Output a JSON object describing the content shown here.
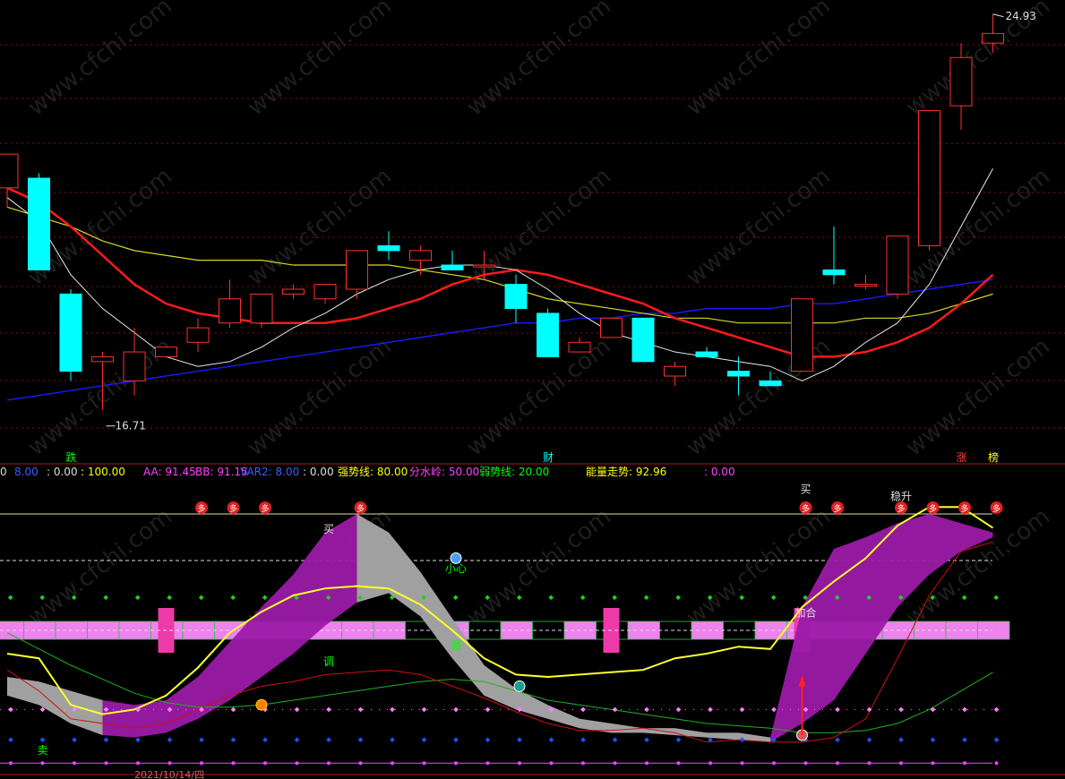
{
  "chart_data": [
    {
      "type": "candlestick",
      "panel": "price",
      "price_high_label": "24.93",
      "price_low_label": "16.71",
      "ylim": [
        15.6,
        25.1
      ],
      "candles": [
        {
          "o": 21.3,
          "h": 22.0,
          "l": 20.9,
          "c": 22.0
        },
        {
          "o": 21.5,
          "h": 21.6,
          "l": 19.6,
          "c": 19.6
        },
        {
          "o": 19.1,
          "h": 19.2,
          "l": 17.3,
          "c": 17.5
        },
        {
          "o": 17.7,
          "h": 17.9,
          "l": 16.7,
          "c": 17.8
        },
        {
          "o": 17.3,
          "h": 18.4,
          "l": 17.0,
          "c": 17.9
        },
        {
          "o": 17.8,
          "h": 18.0,
          "l": 17.8,
          "c": 18.0
        },
        {
          "o": 18.1,
          "h": 18.6,
          "l": 17.9,
          "c": 18.4
        },
        {
          "o": 18.5,
          "h": 19.4,
          "l": 18.4,
          "c": 19.0
        },
        {
          "o": 18.5,
          "h": 19.1,
          "l": 18.4,
          "c": 19.1
        },
        {
          "o": 19.1,
          "h": 19.3,
          "l": 19.0,
          "c": 19.2
        },
        {
          "o": 19.0,
          "h": 19.3,
          "l": 18.9,
          "c": 19.3
        },
        {
          "o": 19.2,
          "h": 20.0,
          "l": 19.0,
          "c": 20.0
        },
        {
          "o": 20.1,
          "h": 20.4,
          "l": 19.8,
          "c": 20.0
        },
        {
          "o": 19.8,
          "h": 20.1,
          "l": 19.5,
          "c": 20.0
        },
        {
          "o": 19.7,
          "h": 20.0,
          "l": 19.6,
          "c": 19.6
        },
        {
          "o": 19.7,
          "h": 20.0,
          "l": 19.4,
          "c": 19.7
        },
        {
          "o": 19.3,
          "h": 19.5,
          "l": 18.5,
          "c": 18.8
        },
        {
          "o": 18.7,
          "h": 18.8,
          "l": 17.8,
          "c": 17.8
        },
        {
          "o": 17.9,
          "h": 18.2,
          "l": 17.9,
          "c": 18.1
        },
        {
          "o": 18.2,
          "h": 18.6,
          "l": 18.2,
          "c": 18.6
        },
        {
          "o": 18.6,
          "h": 18.6,
          "l": 17.7,
          "c": 17.7
        },
        {
          "o": 17.4,
          "h": 17.7,
          "l": 17.2,
          "c": 17.6
        },
        {
          "o": 17.9,
          "h": 18.0,
          "l": 17.8,
          "c": 17.8
        },
        {
          "o": 17.5,
          "h": 17.8,
          "l": 17.0,
          "c": 17.4
        },
        {
          "o": 17.3,
          "h": 17.5,
          "l": 17.2,
          "c": 17.2
        },
        {
          "o": 17.5,
          "h": 19.0,
          "l": 17.5,
          "c": 19.0
        },
        {
          "o": 19.6,
          "h": 20.5,
          "l": 19.3,
          "c": 19.5
        },
        {
          "o": 19.3,
          "h": 19.5,
          "l": 19.2,
          "c": 19.3
        },
        {
          "o": 19.1,
          "h": 20.3,
          "l": 19.0,
          "c": 20.3
        },
        {
          "o": 20.1,
          "h": 22.9,
          "l": 20.0,
          "c": 22.9
        },
        {
          "o": 23.0,
          "h": 24.3,
          "l": 22.5,
          "c": 24.0
        },
        {
          "o": 24.3,
          "h": 24.9,
          "l": 24.1,
          "c": 24.5
        }
      ],
      "ma_white": [
        21.1,
        20.6,
        19.5,
        18.8,
        18.3,
        17.8,
        17.6,
        17.7,
        18.0,
        18.4,
        18.7,
        19.1,
        19.4,
        19.6,
        19.7,
        19.7,
        19.6,
        19.2,
        18.7,
        18.3,
        18.1,
        17.9,
        17.8,
        17.7,
        17.6,
        17.3,
        17.6,
        18.1,
        18.5,
        19.3,
        20.5,
        21.7
      ],
      "ma_red": [
        21.3,
        21.0,
        20.5,
        19.9,
        19.3,
        18.9,
        18.7,
        18.6,
        18.5,
        18.5,
        18.5,
        18.6,
        18.8,
        19.0,
        19.3,
        19.5,
        19.6,
        19.5,
        19.3,
        19.1,
        18.9,
        18.6,
        18.4,
        18.2,
        18.0,
        17.8,
        17.8,
        17.9,
        18.1,
        18.4,
        18.9,
        19.5
      ],
      "ma_yellow": [
        20.9,
        20.7,
        20.5,
        20.2,
        20.0,
        19.9,
        19.8,
        19.8,
        19.8,
        19.7,
        19.7,
        19.7,
        19.7,
        19.6,
        19.5,
        19.4,
        19.2,
        19.0,
        18.9,
        18.8,
        18.7,
        18.6,
        18.6,
        18.5,
        18.5,
        18.5,
        18.5,
        18.6,
        18.6,
        18.7,
        18.9,
        19.1
      ],
      "ma_blue": [
        16.9,
        17.0,
        17.1,
        17.2,
        17.3,
        17.4,
        17.5,
        17.6,
        17.7,
        17.8,
        17.9,
        18.0,
        18.1,
        18.2,
        18.3,
        18.4,
        18.5,
        18.5,
        18.6,
        18.6,
        18.7,
        18.7,
        18.8,
        18.8,
        18.8,
        18.9,
        18.9,
        19.0,
        19.1,
        19.2,
        19.3,
        19.4
      ],
      "markers": [
        {
          "text": "跌",
          "index": 1,
          "color": "#00ff00"
        },
        {
          "text": "财",
          "index": 16,
          "color": "#00ffff"
        },
        {
          "text": "涨",
          "index": 29,
          "color": "#ff4040"
        },
        {
          "text": "榜",
          "index": 30,
          "color": "#ffff00"
        }
      ]
    },
    {
      "type": "indicator",
      "panel": "indicator",
      "ylim": [
        -10,
        110
      ],
      "header": [
        {
          "text": "0",
          "color": "#dddddd"
        },
        {
          "text": "8.00",
          "color": "#3a5cff"
        },
        {
          "text": ": 0.00",
          "color": "#dddddd"
        },
        {
          "text": ": 100.00",
          "color": "#ffff00"
        },
        {
          "text": "AA: 91.45",
          "color": "#ff40ff"
        },
        {
          "text": "BB: 91.15",
          "color": "#ff40ff"
        },
        {
          "text": "VAR2: 8.00",
          "color": "#3a5cff"
        },
        {
          "text": ": 0.00",
          "color": "#dddddd"
        },
        {
          "text": "强势线: 80.00",
          "color": "#ffff00"
        },
        {
          "text": "分水岭: 50.00",
          "color": "#ff40ff"
        },
        {
          "text": "弱势线: 20.00",
          "color": "#00ff00"
        },
        {
          "text": "能量走势: 92.96",
          "color": "#ffff00"
        },
        {
          "text": ": 0.00",
          "color": "#ff40ff"
        }
      ],
      "yellow_line": [
        40,
        38,
        18,
        14,
        16,
        22,
        34,
        49,
        58,
        65,
        68,
        69,
        68,
        61,
        50,
        38,
        31,
        30,
        31,
        32,
        33,
        38,
        40,
        43,
        42,
        60,
        71,
        81,
        95,
        103,
        103,
        94
      ],
      "red_line": [
        33,
        24,
        12,
        10,
        8,
        10,
        16,
        22,
        26,
        28,
        31,
        32,
        33,
        31,
        26,
        21,
        15,
        10,
        7,
        7,
        8,
        6,
        2,
        3,
        2,
        2,
        4,
        12,
        38,
        65,
        84,
        88
      ],
      "green_line": [
        49,
        42,
        35,
        29,
        23,
        19,
        17,
        17,
        18,
        20,
        22,
        24,
        26,
        28,
        29,
        28,
        24,
        20,
        18,
        16,
        14,
        12,
        10,
        9,
        8,
        6,
        6,
        7,
        10,
        16,
        24,
        32
      ],
      "band_top": [
        30,
        28,
        24,
        20,
        18,
        20,
        30,
        45,
        60,
        74,
        92,
        100,
        92,
        75,
        55,
        35,
        25,
        18,
        12,
        10,
        8,
        8,
        6,
        6,
        4,
        60,
        85,
        90,
        96,
        100,
        96,
        92
      ],
      "band_bottom": [
        22,
        18,
        10,
        5,
        4,
        6,
        12,
        20,
        30,
        40,
        52,
        62,
        66,
        56,
        38,
        22,
        16,
        12,
        8,
        6,
        6,
        5,
        4,
        3,
        2,
        10,
        20,
        40,
        60,
        74,
        84,
        90
      ],
      "signals": [
        {
          "text": "多",
          "index": 6
        },
        {
          "text": "多",
          "index": 7
        },
        {
          "text": "多",
          "index": 8
        },
        {
          "text": "多",
          "index": 11
        },
        {
          "text": "多",
          "index": 25
        },
        {
          "text": "多",
          "index": 26
        },
        {
          "text": "多",
          "index": 28
        },
        {
          "text": "多",
          "index": 29
        },
        {
          "text": "多",
          "index": 30
        },
        {
          "text": "多",
          "index": 31
        }
      ],
      "labels": [
        {
          "text": "买",
          "index": 10,
          "value": 92,
          "color": "#dddddd"
        },
        {
          "text": "小心",
          "index": 14,
          "value": 75,
          "color": "#00ff00"
        },
        {
          "text": "调",
          "index": 14,
          "value": 42,
          "color": "#00ff00"
        },
        {
          "text": "调",
          "index": 10,
          "value": 35,
          "color": "#00ff00"
        },
        {
          "text": "买",
          "index": 25,
          "value": 109,
          "color": "#dddddd"
        },
        {
          "text": "稳升",
          "index": 28,
          "value": 106,
          "color": "#dddddd"
        },
        {
          "text": "加合",
          "index": 25,
          "value": 56,
          "color": "#dddddd"
        },
        {
          "text": "卖",
          "index": 1,
          "value": -3,
          "color": "#00ff00"
        }
      ],
      "date_label": "2021/10/14/四",
      "box_highlights": [
        5,
        19,
        25
      ]
    }
  ],
  "watermark": "www.cfchi.com"
}
